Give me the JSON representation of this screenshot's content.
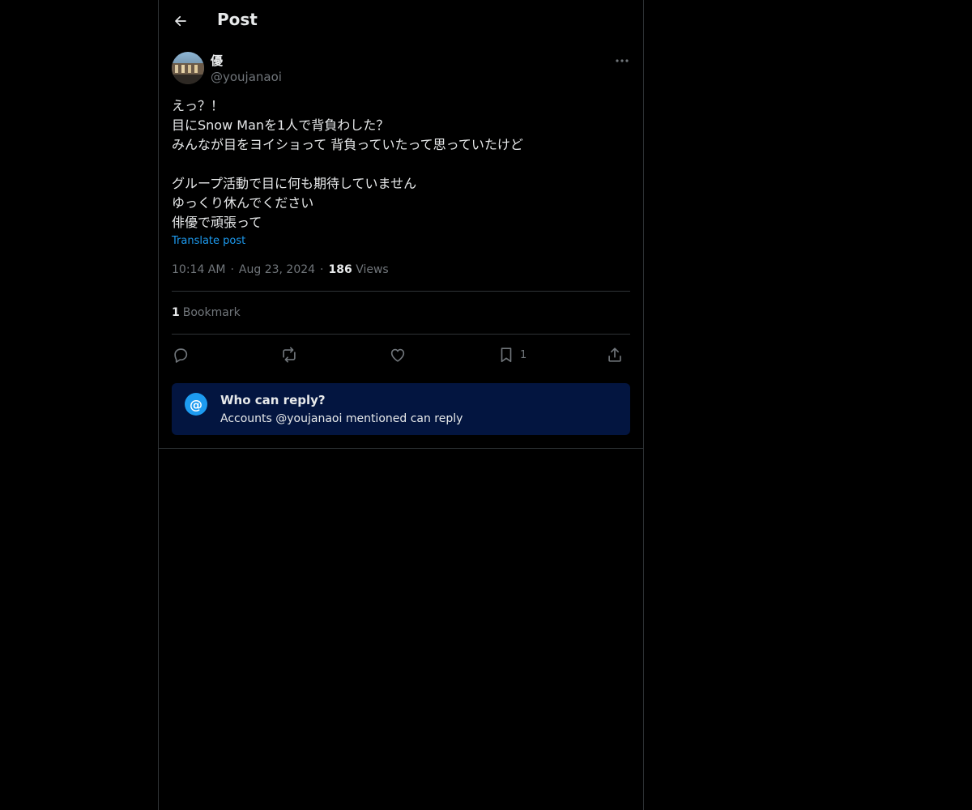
{
  "header": {
    "title": "Post",
    "back_icon": "arrow-left-icon"
  },
  "author": {
    "display_name": "優",
    "handle": "@youjanaoi",
    "avatar": "profile-photo"
  },
  "post": {
    "lines": [
      "えっ？！",
      "目にSnow Manを1人で背負わした？",
      "みんなが目をヨイショって 背負っていたって思っていたけど",
      "",
      "グループ活動で目に何も期待していません",
      "ゆっくり休んでください",
      "俳優で頑張って"
    ],
    "translate_label": "Translate post",
    "time": "10:14 AM",
    "date": "Aug 23, 2024",
    "separator": "·",
    "views_count": "186",
    "views_label": "Views"
  },
  "bookmarks": {
    "count": "1",
    "label": "Bookmark"
  },
  "actions": {
    "reply_icon": "reply-icon",
    "repost_icon": "repost-icon",
    "like_icon": "heart-icon",
    "bookmark_icon": "bookmark-icon",
    "bookmark_count": "1",
    "share_icon": "share-icon"
  },
  "reply_restriction": {
    "icon_glyph": "@",
    "title": "Who can reply?",
    "subtitle": "Accounts @youjanaoi mentioned can reply"
  },
  "colors": {
    "background": "#000000",
    "text": "#e7e9ea",
    "muted": "#71767b",
    "accent": "#1d9bf0",
    "border": "#2f3336",
    "reply_box": "#031540"
  }
}
